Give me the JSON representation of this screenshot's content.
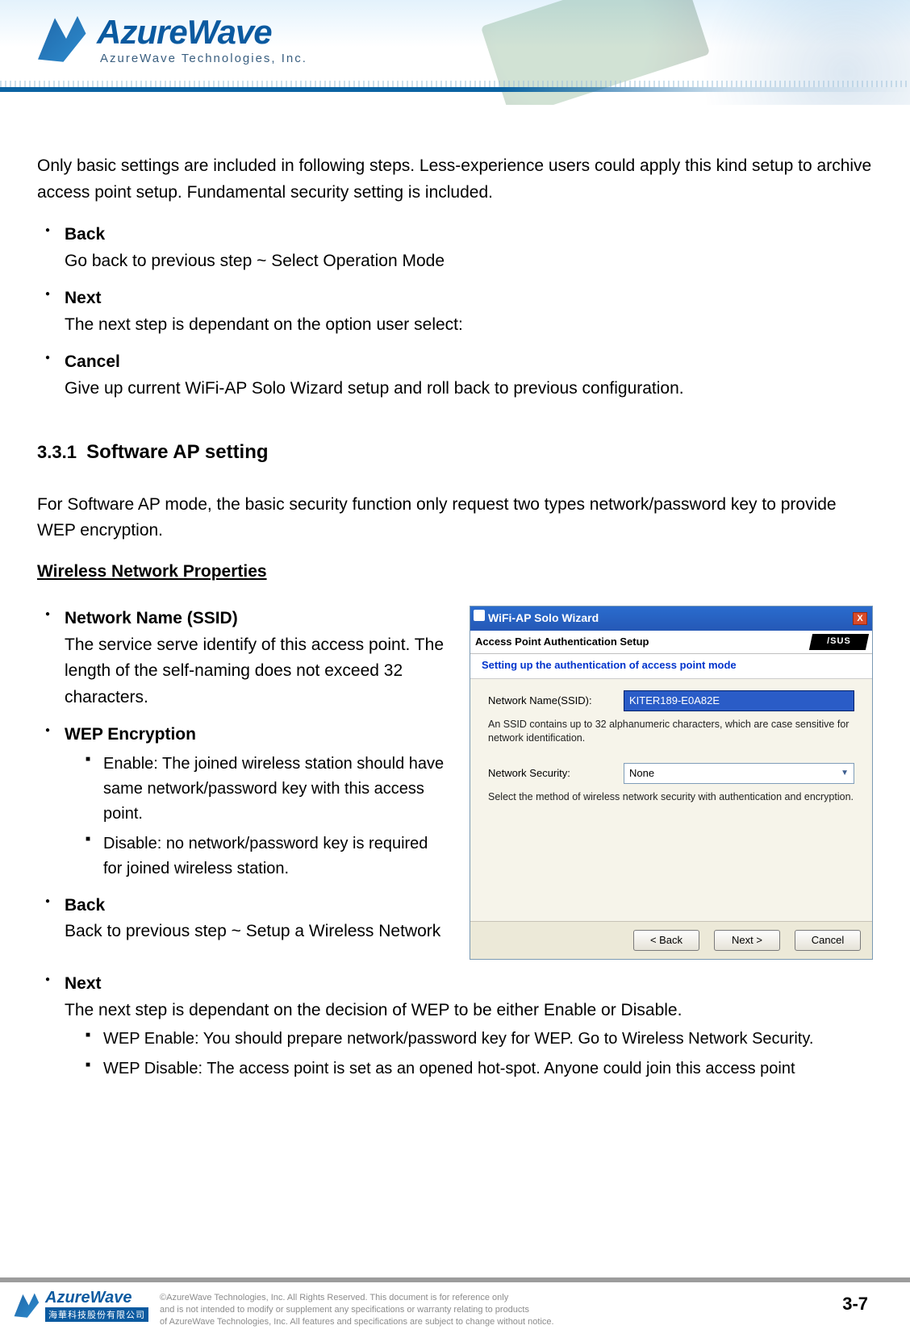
{
  "header": {
    "company_name": "AzureWave",
    "company_sub": "AzureWave  Technologies,  Inc."
  },
  "intro": "Only basic settings are included in following steps. Less-experience users could apply this kind setup to archive access point setup. Fundamental security setting is included.",
  "nav_items": [
    {
      "label": "Back",
      "desc": "Go back to previous step ~ Select Operation Mode"
    },
    {
      "label": "Next",
      "desc": "The next step is dependant on the option user select:"
    },
    {
      "label": "Cancel",
      "desc": "Give up current WiFi-AP Solo Wizard setup and roll back to previous configuration."
    }
  ],
  "section": {
    "num": "3.3.1",
    "title": "Software AP setting"
  },
  "intro2": "For Software AP mode, the basic security function only request two types network/password key to provide WEP encryption.",
  "subhead": "Wireless Network Properties",
  "props": {
    "ssid": {
      "label": "Network Name (SSID)",
      "desc": "The service serve identify of this access point. The length of the self-naming does not exceed 32 characters."
    },
    "wep": {
      "label": "WEP Encryption",
      "items": [
        "Enable: The joined wireless station should have same network/password key with this access point.",
        "Disable: no network/password key is required for joined wireless station."
      ]
    },
    "back": {
      "label": "Back",
      "desc": "Back to previous step ~ Setup a Wireless Network"
    },
    "next": {
      "label": "Next",
      "desc": "The next step is dependant on the decision of WEP to be either Enable or Disable.",
      "items": [
        "WEP Enable: You should prepare network/password key for WEP. Go to Wireless Network Security.",
        "WEP Disable: The access point is set as an opened hot-spot. Anyone could join this access point"
      ]
    }
  },
  "dialog": {
    "title": "WiFi-AP Solo Wizard",
    "close_glyph": "X",
    "brand": "/SUS",
    "heading1": "Access Point Authentication Setup",
    "heading2": "Setting up the authentication of access point mode",
    "ssid_label": "Network Name(SSID):",
    "ssid_value": "KITER189-E0A82E",
    "ssid_help": "An SSID contains up to 32 alphanumeric characters, which are case sensitive for network identification.",
    "sec_label": "Network Security:",
    "sec_value": "None",
    "sec_help": "Select the method of wireless network security with authentication and encryption.",
    "buttons": {
      "back": "< Back",
      "next": "Next >",
      "cancel": "Cancel"
    }
  },
  "footer": {
    "logo_line1": "AzureWave",
    "logo_line2": "海華科技股份有限公司",
    "copy_l1": "©AzureWave Technologies, Inc. All Rights Reserved. This document is for reference only",
    "copy_l2": "and is not intended to modify or supplement any specifications or  warranty relating to products",
    "copy_l3": "of AzureWave Technologies, Inc.  All features and specifications are subject to change without notice.",
    "page": "3-7"
  }
}
